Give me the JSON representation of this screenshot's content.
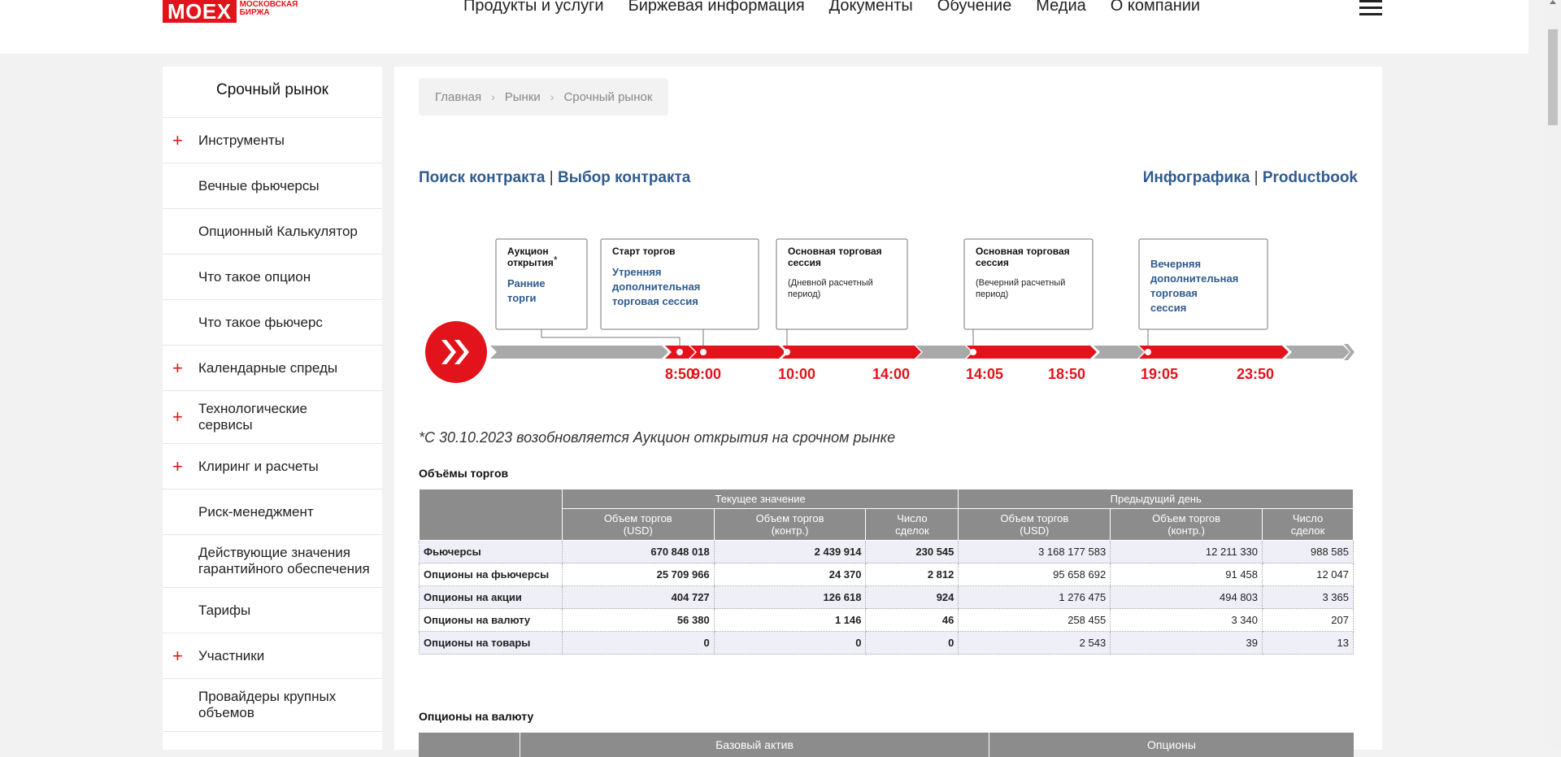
{
  "logo": {
    "mark": "MOEX",
    "subtitle_line1": "МОСКОВСКАЯ",
    "subtitle_line2": "БИРЖА"
  },
  "topnav": [
    "Продукты и услуги",
    "Биржевая информация",
    "Документы",
    "Обучение",
    "Медиа",
    "О компании"
  ],
  "sidebar": {
    "title": "Срочный рынок",
    "items": [
      {
        "label": "Инструменты",
        "plus": true,
        "line2": ""
      },
      {
        "label": "Вечные фьючерсы",
        "plus": false,
        "line2": ""
      },
      {
        "label": "Опционный Калькулятор",
        "plus": false,
        "line2": ""
      },
      {
        "label": "Что такое опцион",
        "plus": false,
        "line2": ""
      },
      {
        "label": "Что такое фьючерс",
        "plus": false,
        "line2": ""
      },
      {
        "label": "Календарные спреды",
        "plus": true,
        "line2": ""
      },
      {
        "label": "Технологические",
        "plus": true,
        "line2": "сервисы"
      },
      {
        "label": "Клиринг и расчеты",
        "plus": true,
        "line2": ""
      },
      {
        "label": "Риск-менеджмент",
        "plus": false,
        "line2": ""
      },
      {
        "label": "Действующие значения",
        "plus": false,
        "line2": "гарантийного обеспечения"
      },
      {
        "label": "Тарифы",
        "plus": false,
        "line2": ""
      },
      {
        "label": "Участники",
        "plus": true,
        "line2": ""
      },
      {
        "label": "Провайдеры крупных",
        "plus": false,
        "line2": "объемов"
      }
    ],
    "plus_symbol": "+"
  },
  "breadcrumb": [
    "Главная",
    "Рынки",
    "Срочный рынок"
  ],
  "breadcrumb_sep": "›",
  "links_left": [
    "Поиск контракта",
    "Выбор контракта"
  ],
  "links_right": [
    "Инфографика",
    "Productbook"
  ],
  "pipe": "|",
  "timeline": {
    "boxes": [
      {
        "title": "Аукцион открытия",
        "star": "*",
        "sub": "Ранние торги",
        "note": ""
      },
      {
        "title": "Старт торгов",
        "star": "",
        "sub": "Утренняя дополнительная торговая сессия",
        "note": ""
      },
      {
        "title": "Основная торговая сессия",
        "star": "",
        "sub": "",
        "note": "(Дневной расчетный период)"
      },
      {
        "title": "Основная торговая сессия",
        "star": "",
        "sub": "",
        "note": "(Вечерний расчетный период)"
      },
      {
        "title": "",
        "star": "",
        "sub": "Вечерняя дополнительная торговая сессия",
        "note": ""
      }
    ],
    "times": [
      "8:50",
      "9:00",
      "10:00",
      "14:00",
      "14:05",
      "18:50",
      "19:05",
      "23:50"
    ]
  },
  "note": "*С 30.10.2023 возобновляется Аукцион открытия на срочном рынке",
  "volumes": {
    "title": "Объёмы торгов",
    "group_current": "Текущее значение",
    "group_prev": "Предыдущий день",
    "col1": "Объем торгов",
    "col1b": "(USD)",
    "col2": "Объем торгов",
    "col2b": "(контр.)",
    "col3": "Число",
    "col3b": "сделок",
    "rows": [
      {
        "name": "Фьючерсы",
        "v": [
          "670 848 018",
          "2 439 914",
          "230 545",
          "3 168 177 583",
          "12 211 330",
          "988 585"
        ]
      },
      {
        "name": "Опционы на фьючерсы",
        "v": [
          "25 709 966",
          "24 370",
          "2 812",
          "95 658 692",
          "91 458",
          "12 047"
        ]
      },
      {
        "name": "Опционы на акции",
        "v": [
          "404 727",
          "126 618",
          "924",
          "1 276 475",
          "494 803",
          "3 365"
        ]
      },
      {
        "name": "Опционы на валюту",
        "v": [
          "56 380",
          "1 146",
          "46",
          "258 455",
          "3 340",
          "207"
        ]
      },
      {
        "name": "Опционы на товары",
        "v": [
          "0",
          "0",
          "0",
          "2 543",
          "39",
          "13"
        ]
      }
    ]
  },
  "fx": {
    "title": "Опционы на валюту",
    "head": [
      "",
      "Базовый актив",
      "Опционы"
    ]
  },
  "colors": {
    "accent": "#e3131b",
    "link": "#2f5b8f",
    "header_gray": "#8c8c8c"
  }
}
